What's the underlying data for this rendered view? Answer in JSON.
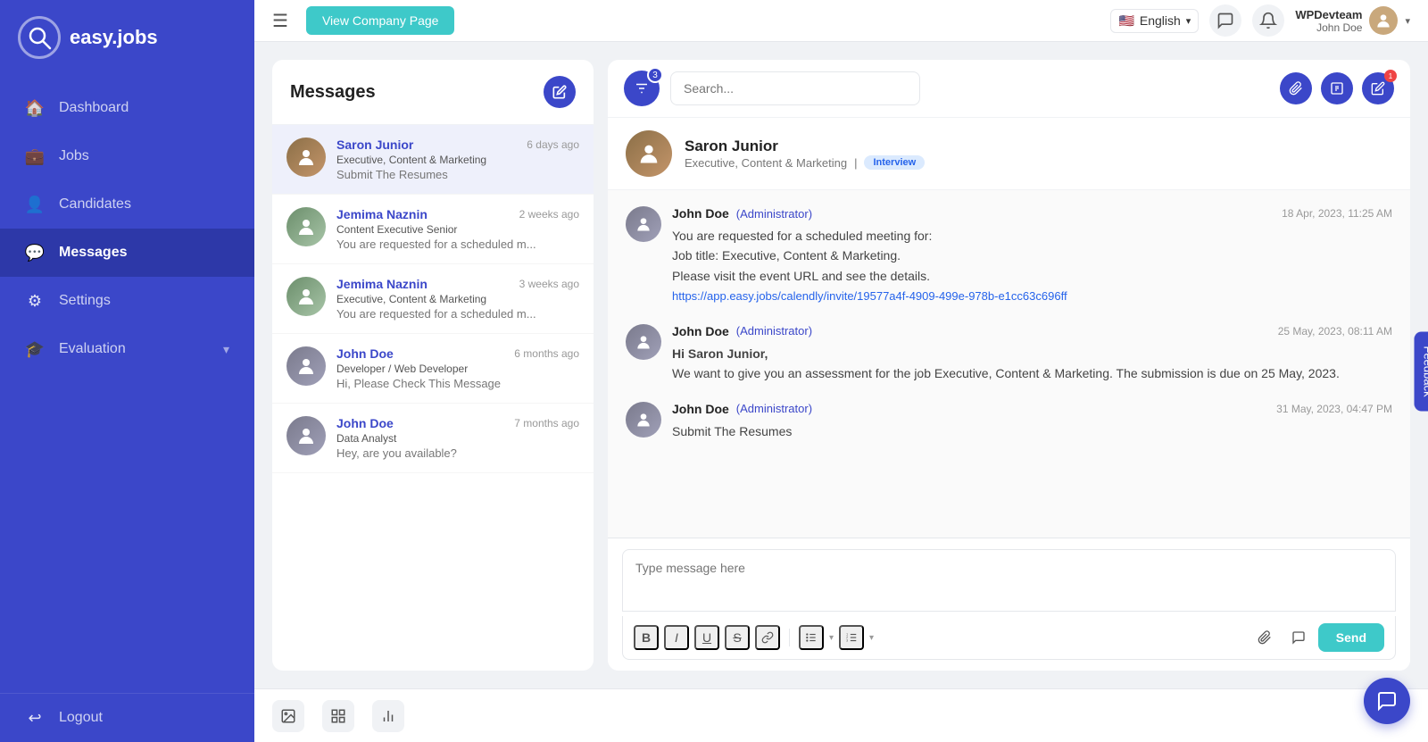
{
  "app": {
    "name": "easy.jobs",
    "logo_symbol": "🔍"
  },
  "topbar": {
    "menu_icon": "☰",
    "view_company_label": "View Company Page",
    "language": "English",
    "language_flag": "🇺🇸",
    "company_name": "WPDevteam",
    "username": "John Doe"
  },
  "sidebar": {
    "items": [
      {
        "id": "dashboard",
        "label": "Dashboard",
        "icon": "🏠"
      },
      {
        "id": "jobs",
        "label": "Jobs",
        "icon": "💼"
      },
      {
        "id": "candidates",
        "label": "Candidates",
        "icon": "👤"
      },
      {
        "id": "messages",
        "label": "Messages",
        "icon": "💬",
        "active": true
      },
      {
        "id": "settings",
        "label": "Settings",
        "icon": "⚙"
      },
      {
        "id": "evaluation",
        "label": "Evaluation",
        "icon": "🎓",
        "has_arrow": true
      }
    ],
    "logout": {
      "label": "Logout",
      "icon": "↩"
    }
  },
  "messages_panel": {
    "title": "Messages",
    "compose_icon": "✏",
    "items": [
      {
        "id": "msg1",
        "sender": "Saron Junior",
        "role": "Executive, Content & Marketing",
        "preview": "Submit The Resumes",
        "time": "6 days ago",
        "active": true
      },
      {
        "id": "msg2",
        "sender": "Jemima Naznin",
        "role": "Content Executive Senior",
        "preview": "You are requested for a scheduled m...",
        "time": "2 weeks ago",
        "active": false
      },
      {
        "id": "msg3",
        "sender": "Jemima Naznin",
        "role": "Executive, Content & Marketing",
        "preview": "You are requested for a scheduled m...",
        "time": "3 weeks ago",
        "active": false
      },
      {
        "id": "msg4",
        "sender": "John Doe",
        "role": "Developer / Web Developer",
        "preview": "Hi, Please Check This Message",
        "time": "6 months ago",
        "active": false
      },
      {
        "id": "msg5",
        "sender": "John Doe",
        "role": "Data Analyst",
        "preview": "Hey, are you available?",
        "time": "7 months ago",
        "active": false
      }
    ]
  },
  "chat_panel": {
    "filter_badge": "3",
    "search_placeholder": "Search...",
    "contact": {
      "name": "Saron Junior",
      "role": "Executive, Content & Marketing",
      "tag": "Interview"
    },
    "messages": [
      {
        "id": "chatmsg1",
        "sender": "John Doe",
        "role": "(Administrator)",
        "time": "18 Apr, 2023, 11:25 AM",
        "text": "You are requested for a scheduled meeting for:\nJob title: Executive, Content & Marketing.\nPlease visit the event URL and see the details.",
        "link": "https://app.easy.jobs/calendly/invite/19577a4f-4909-499e-978b-e1cc63c696ff"
      },
      {
        "id": "chatmsg2",
        "sender": "John Doe",
        "role": "(Administrator)",
        "time": "25 May, 2023, 08:11 AM",
        "greeting": "Hi Saron Junior,",
        "text": "We want to give you an assessment for the job Executive, Content & Marketing. The submission is due on 25 May, 2023.",
        "link": ""
      },
      {
        "id": "chatmsg3",
        "sender": "John Doe",
        "role": "(Administrator)",
        "time": "31 May, 2023, 04:47 PM",
        "text": "Submit The Resumes",
        "link": ""
      }
    ],
    "input_placeholder": "Type message here",
    "send_label": "Send",
    "toolbar": {
      "bold": "B",
      "italic": "I",
      "underline": "U",
      "strikethrough": "S",
      "link": "🔗",
      "list_bullet": "≡",
      "list_ordered": "≡"
    }
  },
  "bottom_bar": {
    "icons": [
      "📷",
      "📊",
      "📈"
    ]
  },
  "feedback": {
    "label": "Feedback"
  }
}
